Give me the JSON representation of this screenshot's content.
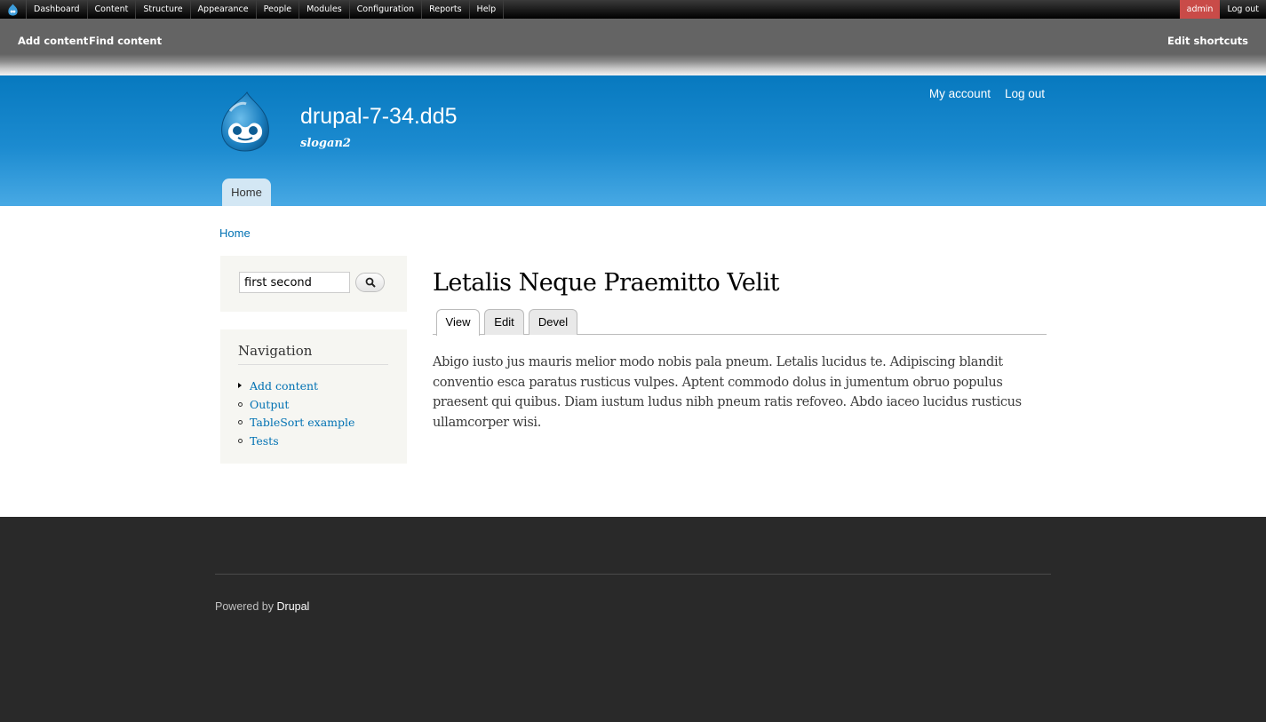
{
  "toolbar": {
    "items": [
      "Dashboard",
      "Content",
      "Structure",
      "Appearance",
      "People",
      "Modules",
      "Configuration",
      "Reports",
      "Help"
    ],
    "user": "admin",
    "logout": "Log out"
  },
  "shortcuts": {
    "add_content": "Add content",
    "find_content": "Find content",
    "edit_shortcuts": "Edit shortcuts"
  },
  "header": {
    "site_name": "drupal-7-34.dd5",
    "slogan": "slogan2",
    "secondary_menu": [
      "My account",
      "Log out"
    ],
    "main_menu": [
      "Home"
    ]
  },
  "breadcrumb": "Home",
  "search": {
    "value": "first second"
  },
  "navigation": {
    "title": "Navigation",
    "items": [
      "Add content",
      "Output",
      "TableSort example",
      "Tests"
    ]
  },
  "content": {
    "title": "Letalis Neque Praemitto Velit",
    "tabs": [
      "View",
      "Edit",
      "Devel"
    ],
    "body": "Abigo iusto jus mauris melior modo nobis pala pneum. Letalis lucidus te. Adipiscing blandit conventio esca paratus rusticus vulpes. Aptent commodo dolus in jumentum obruo populus praesent qui quibus. Diam iustum ludus nibh pneum ratis refoveo. Abdo iaceo lucidus rusticus ullamcorper wisi."
  },
  "footer": {
    "powered_prefix": "Powered by",
    "powered_link": "Drupal"
  },
  "colors": {
    "header_top": "#0779bf",
    "header_bottom": "#48a9e4",
    "link": "#0071b3",
    "admin_badge": "#c94b48",
    "footer_bg": "#292929"
  }
}
